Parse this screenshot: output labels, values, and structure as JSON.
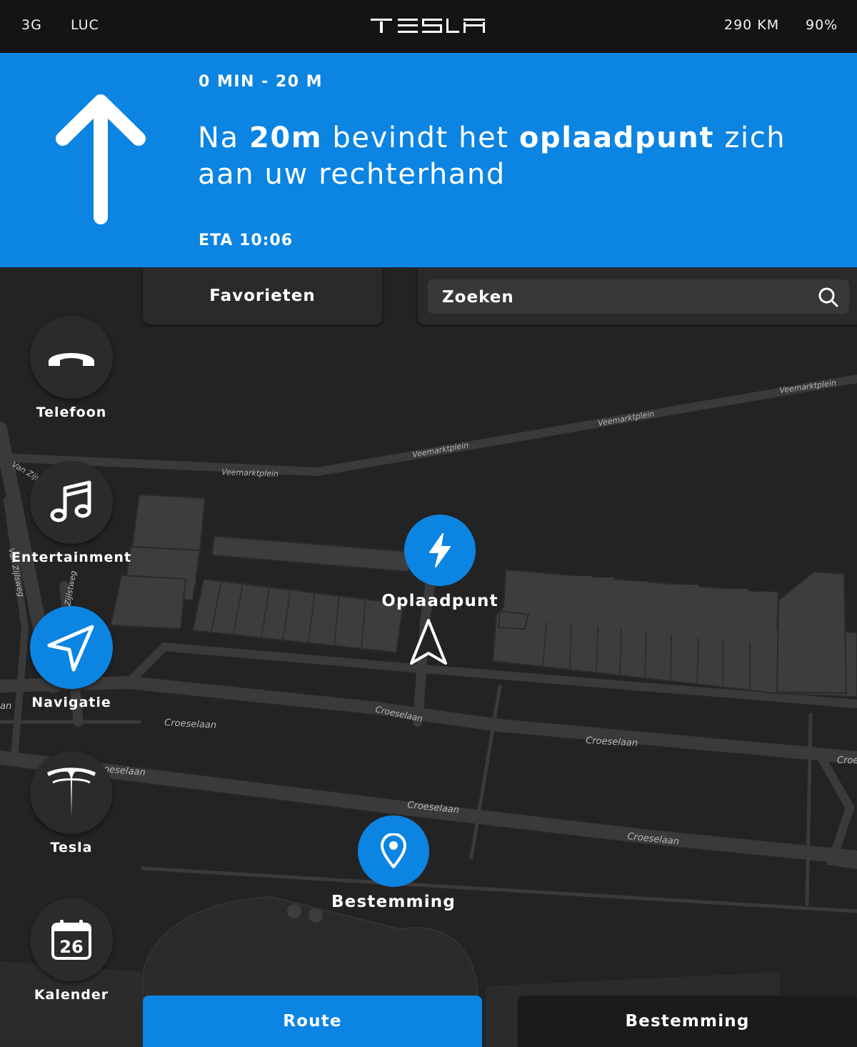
{
  "statusbar": {
    "network": "3G",
    "user": "LUC",
    "brand": "TESLA",
    "range": "290 KM",
    "battery": "90%"
  },
  "navigation": {
    "distance_time": "0 MIN - 20 M",
    "instruction": {
      "p1": "Na ",
      "b1": "20m",
      "p2": " bevindt het ",
      "b2": "oplaadpunt",
      "p3": " zich aan uw rechterhand"
    },
    "eta": "ETA 10:06",
    "direction_icon": "arrow-up-icon"
  },
  "favorites": {
    "label": "Favorieten"
  },
  "search": {
    "placeholder": "Zoeken",
    "icon": "search-icon"
  },
  "dock": [
    {
      "label": "Telefoon",
      "icon": "phone-icon"
    },
    {
      "label": "Entertainment",
      "icon": "music-icon"
    },
    {
      "label": "Navigatie",
      "icon": "navigation-icon",
      "active": true
    },
    {
      "label": "Tesla",
      "icon": "tesla-logo-icon"
    },
    {
      "label": "Kalender",
      "icon": "calendar-icon",
      "day": "26"
    }
  ],
  "map": {
    "streets": [
      "Veemarktplein",
      "Veemarktplein",
      "Veemarktplein",
      "Veemarktplein",
      "Van Zijs",
      "Van Zijlsweg",
      "Zijlstweg",
      "Croeselaan",
      "Croeselaan",
      "Croeselaan",
      "Croeselaan",
      "Croeselaan",
      "oeselaan",
      "Croe",
      "an"
    ],
    "pins": [
      {
        "label": "Oplaadpunt",
        "icon": "lightning-icon"
      },
      {
        "label": "Bestemming",
        "icon": "location-pin-icon"
      }
    ],
    "car_icon": "car-position-arrow-icon"
  },
  "tabs": {
    "route": "Route",
    "destination": "Bestemming"
  },
  "colors": {
    "accent": "#0b84e2",
    "map_bg": "#232323",
    "road": "#3a3a3a",
    "building": "#3d3d3d",
    "statusbar": "#141414"
  }
}
